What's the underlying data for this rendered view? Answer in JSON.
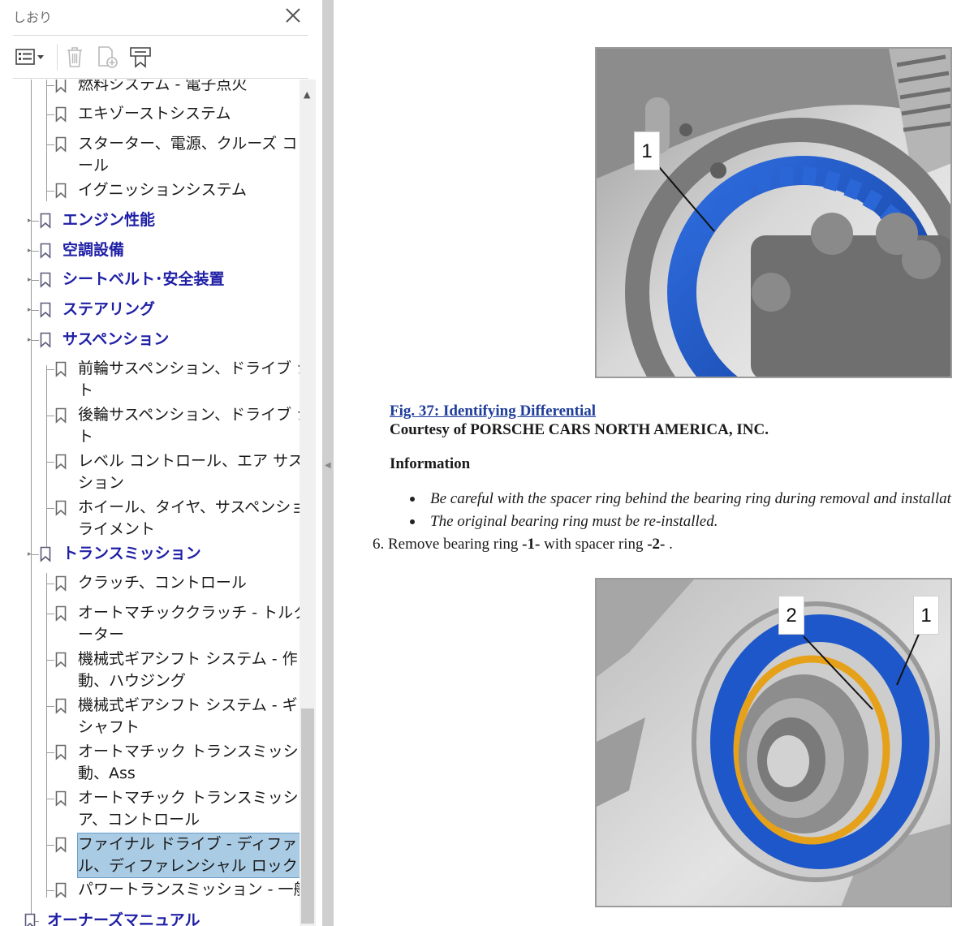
{
  "panel": {
    "title": "しおり",
    "items": [
      {
        "label": "燃料システム - 電子点火",
        "kind": "child"
      },
      {
        "label": "エキゾーストシステム",
        "kind": "child"
      },
      {
        "label": "スターター、電源、クルーズ コントロ",
        "label2": "ール",
        "kind": "child"
      },
      {
        "label": "イグニッションシステム",
        "kind": "child"
      },
      {
        "label": "エンジン性能",
        "kind": "parent"
      },
      {
        "label": "空調設備",
        "kind": "parent"
      },
      {
        "label": "シートベルト･安全装置",
        "kind": "parent"
      },
      {
        "label": "ステアリング",
        "kind": "parent"
      },
      {
        "label": "サスペンション",
        "kind": "parent"
      },
      {
        "label": "前輪サスペンション、ドライブ シャフ",
        "label2": "ト",
        "kind": "child"
      },
      {
        "label": "後輪サスペンション、ドライブ シャフ",
        "label2": "ト",
        "kind": "child"
      },
      {
        "label": "レベル コントロール、エア サスペン",
        "label2": "ション",
        "kind": "child"
      },
      {
        "label": "ホイール、タイヤ、サスペンション ア",
        "label2": "ライメント",
        "kind": "child"
      },
      {
        "label": "トランスミッション",
        "kind": "parent"
      },
      {
        "label": "クラッチ、コントロール",
        "kind": "child"
      },
      {
        "label": "オートマチッククラッチ - トルクコンバ",
        "label2": "ーター",
        "kind": "child"
      },
      {
        "label": "機械式ギアシフト システム - 作",
        "label2": "動、ハウジング",
        "kind": "child"
      },
      {
        "label": "機械式ギアシフト システム - ギアと",
        "label2": "シャフト",
        "kind": "child"
      },
      {
        "label": "オートマチック トランスミッション - 作",
        "label2": "動、Ass",
        "kind": "child"
      },
      {
        "label": "オートマチック トランスミッション - ギ",
        "label2": "ア、コントロール",
        "kind": "child"
      },
      {
        "label": "ファイナル ドライブ - ディファレンシャ",
        "label2": "ル、ディファレンシャル ロック",
        "kind": "selected"
      },
      {
        "label": "パワートランスミッション - 一般",
        "kind": "child"
      },
      {
        "label": "オーナーズマニュアル",
        "kind": "root"
      }
    ]
  },
  "doc": {
    "figure1_callout": "1",
    "caption_link": "Fig. 37: Identifying Differential",
    "caption_courtesy": "Courtesy of PORSCHE CARS NORTH AMERICA, INC.",
    "info_heading": "Information",
    "bullet1": "Be careful with the spacer ring behind the bearing ring during removal and installat",
    "bullet2": "The original bearing ring must be re-installed.",
    "step_number": "6.",
    "step_text_1": "Remove bearing ring ",
    "step_ref_1": "-1-",
    "step_text_2": " with spacer ring ",
    "step_ref_2": "-2-",
    "step_text_3": " .",
    "figure2_callout_a": "2",
    "figure2_callout_b": "1"
  },
  "colors": {
    "parent_link": "#1f1fa6",
    "selection": "#a9cbe4",
    "caption_link": "#1f3d9a",
    "ring_blue": "#1d57c9",
    "spacer_orange": "#e6a11a"
  }
}
